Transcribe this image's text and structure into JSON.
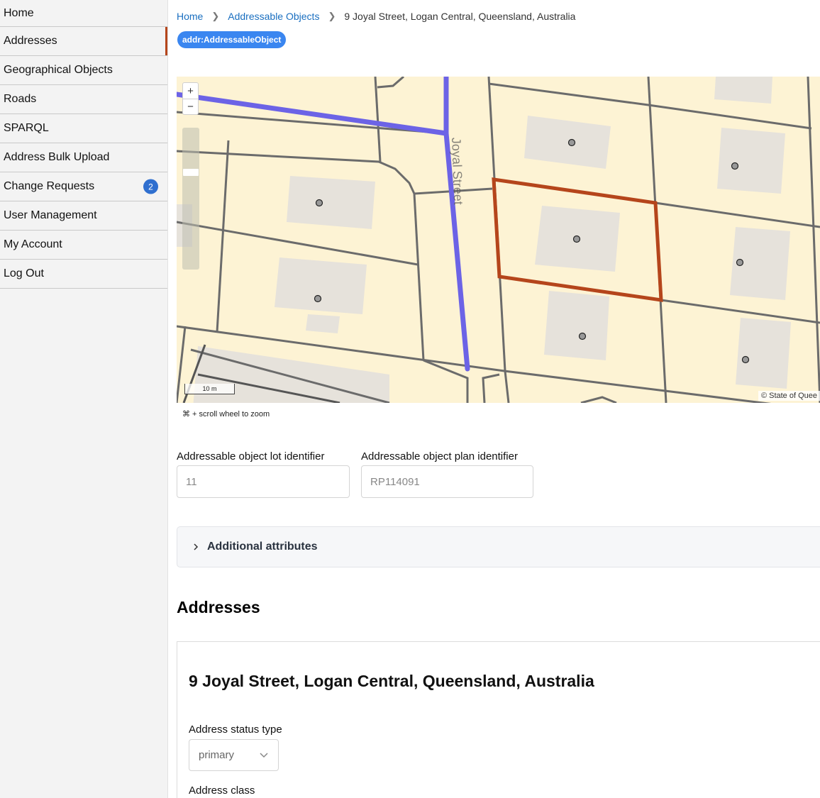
{
  "sidebar": {
    "items": [
      {
        "label": "Home"
      },
      {
        "label": "Addresses"
      },
      {
        "label": "Geographical Objects"
      },
      {
        "label": "Roads"
      },
      {
        "label": "SPARQL"
      },
      {
        "label": "Address Bulk Upload"
      },
      {
        "label": "Change Requests",
        "badge": "2"
      },
      {
        "label": "User Management"
      },
      {
        "label": "My Account"
      },
      {
        "label": "Log Out"
      }
    ],
    "active_item": "Addresses",
    "active_color": "#b5451b",
    "badge_color": "#2f6fcf"
  },
  "breadcrumb": {
    "items": [
      "Home",
      "Addressable Objects",
      "9 Joyal Street, Logan Central, Queensland, Australia"
    ]
  },
  "type_badge": "addr:AddressableObject",
  "map": {
    "zoom_in": "+",
    "zoom_out": "−",
    "scale_label": "10 m",
    "attribution": "© State of Quee",
    "street_label": "Joyal Street",
    "hint": "⌘ + scroll wheel to zoom",
    "colors": {
      "land": "#fdf3d4",
      "road": "#6c63e6",
      "selected_parcel": "#b5451b",
      "building": "#e6e2db",
      "boundary": "#6b6b6b"
    }
  },
  "fields": {
    "lot": {
      "label": "Addressable object lot identifier",
      "value": "11"
    },
    "plan": {
      "label": "Addressable object plan identifier",
      "value": "RP114091"
    }
  },
  "accordion": {
    "title": "Additional attributes"
  },
  "addresses_section": {
    "title": "Addresses",
    "card": {
      "title": "9 Joyal Street, Logan Central, Queensland, Australia",
      "status_label": "Address status type",
      "status_value": "primary",
      "class_label": "Address class"
    }
  }
}
